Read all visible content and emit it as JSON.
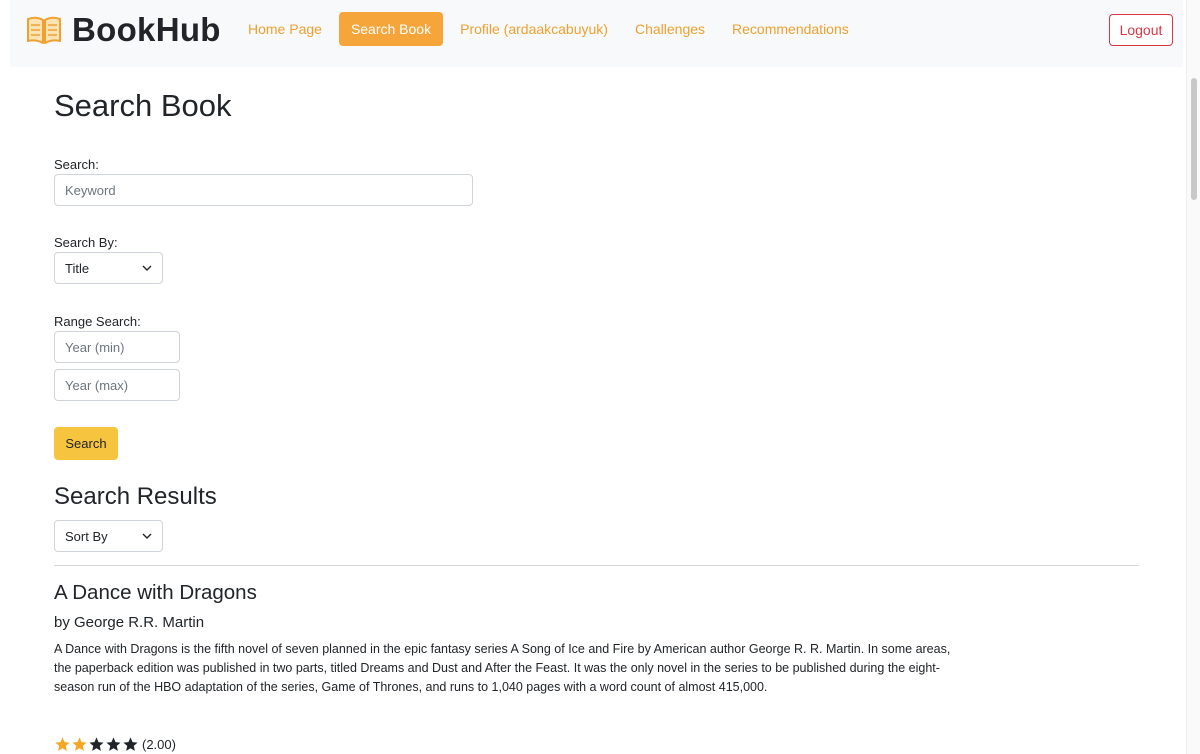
{
  "app": {
    "brand": "BookHub"
  },
  "nav": {
    "links": [
      "Home Page",
      "Search Book",
      "Profile (ardaakcabuyuk)",
      "Challenges",
      "Recommendations"
    ],
    "active_index": 1,
    "logout_label": "Logout"
  },
  "page": {
    "title": "Search Book"
  },
  "form": {
    "search_label": "Search:",
    "search_placeholder": "Keyword",
    "search_by_label": "Search By:",
    "search_by_value": "Title",
    "range_label": "Range Search:",
    "year_min_placeholder": "Year (min)",
    "year_max_placeholder": "Year (max)",
    "submit_label": "Search"
  },
  "results": {
    "title": "Search Results",
    "sort_value": "Sort By",
    "items": [
      {
        "title": "A Dance with Dragons",
        "author": "by George R.R. Martin",
        "description": "A Dance with Dragons is the fifth novel of seven planned in the epic fantasy series A Song of Ice and Fire by American author George R. R. Martin. In some areas, the paperback edition was published in two parts, titled Dreams and Dust and After the Feast. It was the only novel in the series to be published during the eight-season run of the HBO adaptation of the series, Game of Thrones, and runs to 1,040 pages with a word count of almost 415,000.",
        "rating": 2.0,
        "rating_text": "(2.00)"
      }
    ]
  },
  "colors": {
    "accent": "#f5a53a",
    "button": "#f7c440",
    "logout": "#dc3545",
    "star_filled": "#f5a623",
    "star_empty": "#212529"
  },
  "icons": {
    "brand": "open-book-icon",
    "dropdown": "chevron-down-icon",
    "rating": "star-icon"
  }
}
